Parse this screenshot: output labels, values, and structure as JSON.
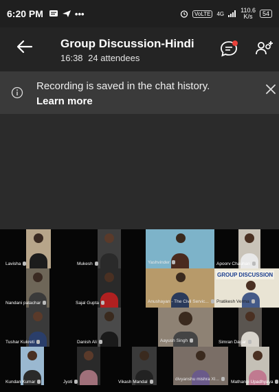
{
  "status_bar": {
    "time": "6:20 PM",
    "left_icons": [
      "message-icon",
      "send-icon"
    ],
    "more": "•••",
    "volte": "VoLTE",
    "network": "4G",
    "speed_value": "110.6",
    "speed_unit": "K/s",
    "battery": "54"
  },
  "header": {
    "title": "Group Discussion-Hindi",
    "time": "16:38",
    "attendees": "24 attendees"
  },
  "banner": {
    "message": "Recording is saved in the chat history.",
    "link": "Learn more"
  },
  "participants": [
    {
      "name": "Lavisha"
    },
    {
      "name": "Mukesh"
    },
    {
      "name": "Yashvinder"
    },
    {
      "name": "Apoorv Chauhan"
    },
    {
      "name": "Nandani patachar"
    },
    {
      "name": "Sajal Gupta"
    },
    {
      "name": "Anushayan - The Civil Servic..."
    },
    {
      "name": "Pratikesh Verma"
    },
    {
      "name": "Tushar Kukreti"
    },
    {
      "name": "Danish Ali"
    },
    {
      "name": "Aayush Singh"
    },
    {
      "name": "Simran Dagar"
    },
    {
      "name": "Kundan Kumar"
    },
    {
      "name": "Jyoti"
    },
    {
      "name": "Vikash Mandal"
    },
    {
      "name": "divyanshu mishra XI..."
    },
    {
      "name": "Mathangi Upadhyaya"
    }
  ],
  "board_text": "GROUP DISCUSSION",
  "colors": {
    "accent_dot": "#e8413a",
    "banner_bg": "#3a3a3a",
    "header_bg": "#242424"
  }
}
